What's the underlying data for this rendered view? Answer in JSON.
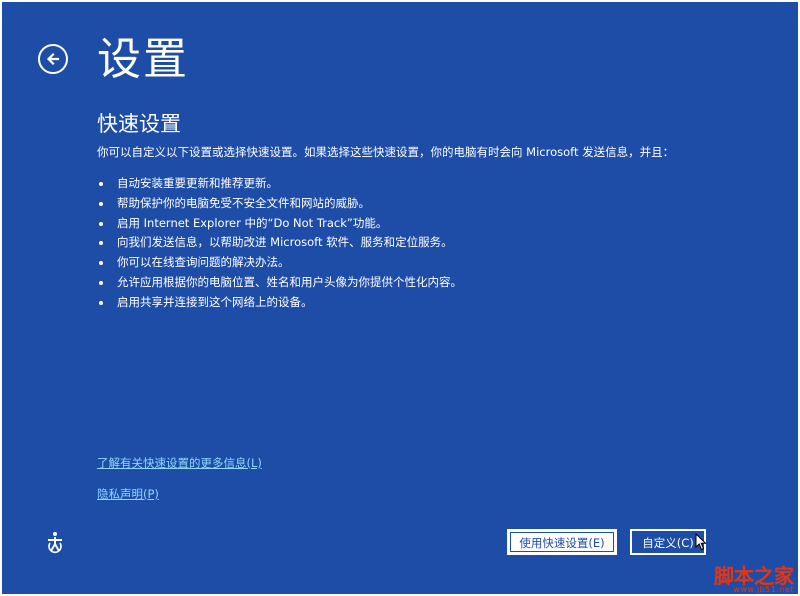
{
  "header": {
    "title": "设置"
  },
  "section": {
    "title": "快速设置",
    "intro": "你可以自定义以下设置或选择快速设置。如果选择这些快速设置，你的电脑有时会向 Microsoft 发送信息，并且："
  },
  "bullets": [
    "自动安装重要更新和推荐更新。",
    "帮助保护你的电脑免受不安全文件和网站的威胁。",
    "启用 Internet Explorer 中的“Do Not Track”功能。",
    "向我们发送信息，以帮助改进 Microsoft 软件、服务和定位服务。",
    "你可以在线查询问题的解决办法。",
    "允许应用根据你的电脑位置、姓名和用户头像为你提供个性化内容。",
    "启用共享并连接到这个网络上的设备。"
  ],
  "links": {
    "learn_more": "了解有关快速设置的更多信息(L)",
    "privacy": "隐私声明(P)"
  },
  "buttons": {
    "express": "使用快速设置(E)",
    "customize": "自定义(C)"
  },
  "watermark": {
    "main": "脚本之家",
    "sub": "www.jb51.net"
  },
  "icons": {
    "back": "back-arrow-icon",
    "ease_of_access": "ease-of-access-icon",
    "cursor": "mouse-cursor-icon"
  },
  "colors": {
    "background": "#1e4da7",
    "link": "#8fd8ff",
    "watermark": "#e8350f"
  }
}
